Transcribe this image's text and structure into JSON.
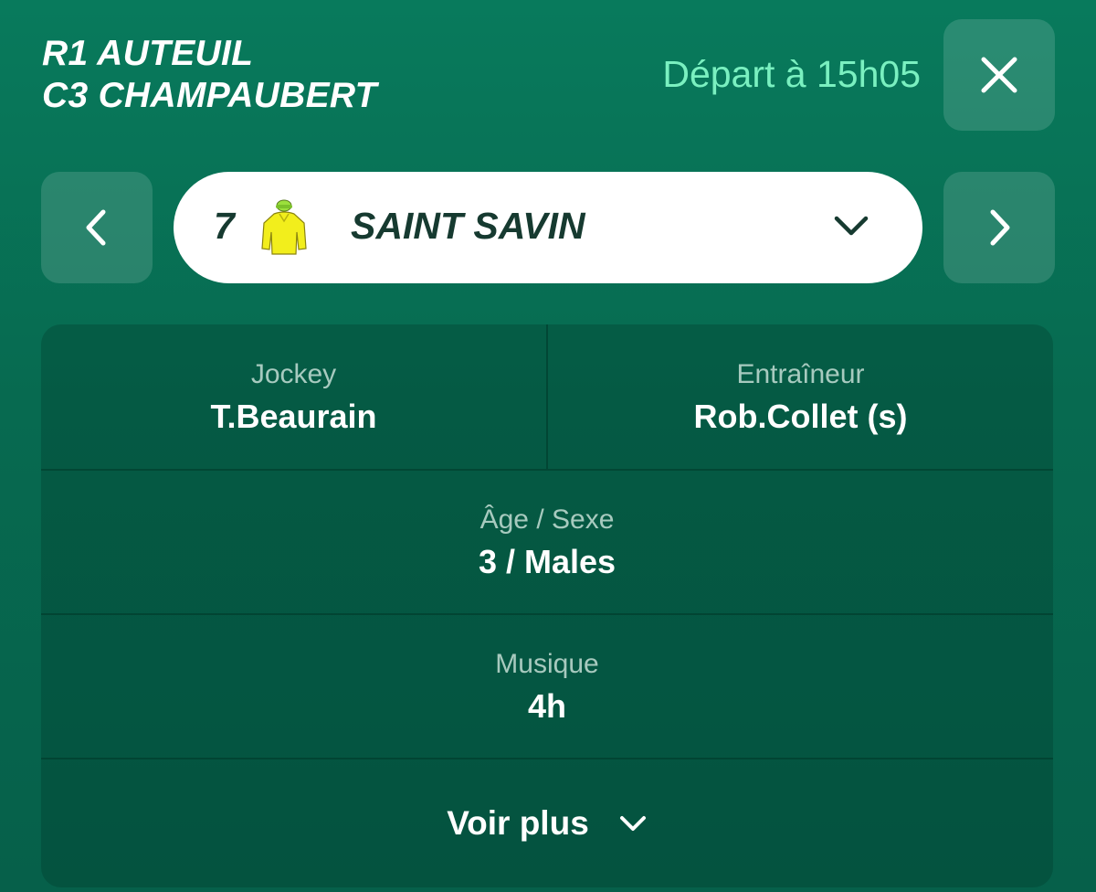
{
  "header": {
    "meeting": "R1 AUTEUIL",
    "race": "C3 CHAMPAUBERT",
    "departure": "Départ à 15h05"
  },
  "icons": {
    "close": "close-icon",
    "prev": "chevron-left-icon",
    "next": "chevron-right-icon",
    "dropdown": "chevron-down-icon",
    "silk": "jockey-silk-icon"
  },
  "colors": {
    "background": "#087a5c",
    "departure_text": "#7af0c0",
    "silk_body": "#f2ee1c",
    "silk_cap": "#9be03c",
    "selector_text": "#163a30"
  },
  "runner": {
    "number": "7",
    "name": "SAINT SAVIN"
  },
  "details": {
    "jockey_label": "Jockey",
    "jockey_value": "T.Beaurain",
    "trainer_label": "Entraîneur",
    "trainer_value": "Rob.Collet (s)",
    "age_sex_label": "Âge / Sexe",
    "age_sex_value": "3 / Males",
    "music_label": "Musique",
    "music_value": "4h",
    "more_label": "Voir plus"
  }
}
